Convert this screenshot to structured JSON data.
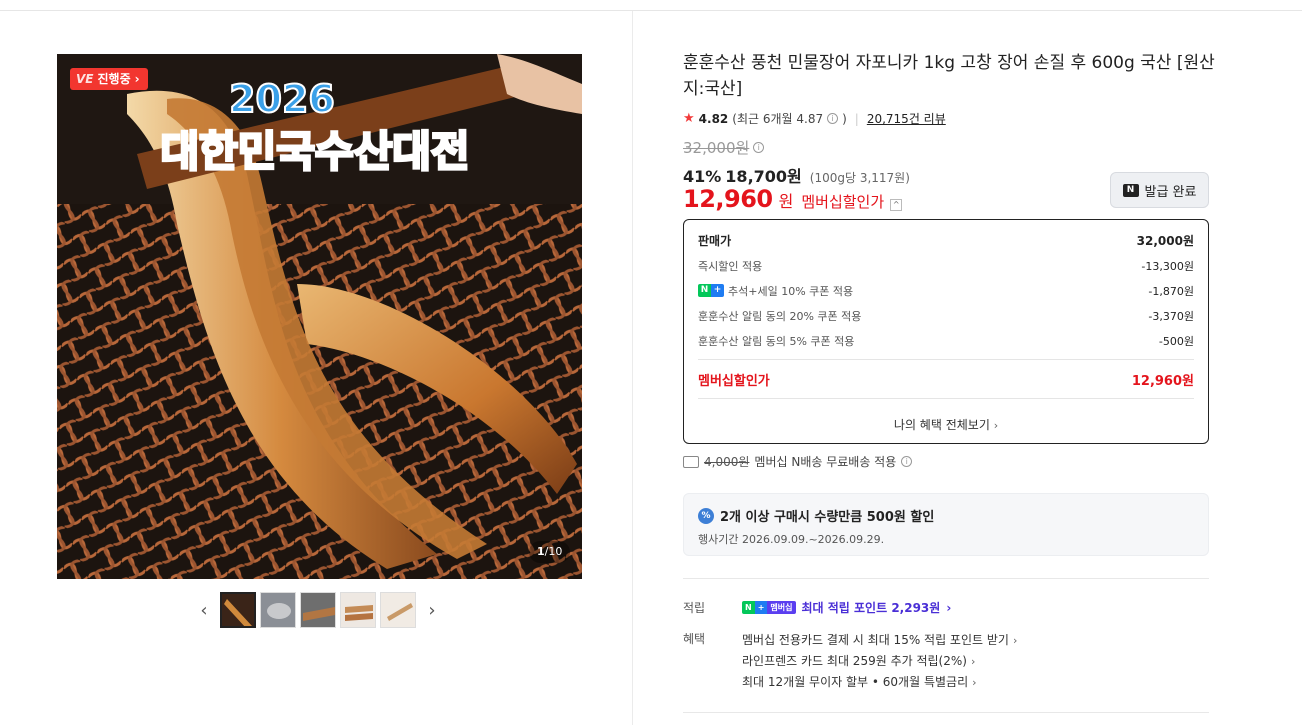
{
  "gallery": {
    "live_badge_prefix": "VE",
    "live_badge_label": "진행중",
    "banner_year": "2026",
    "banner_title": "대한민국수산대전",
    "counter_current": "1",
    "counter_total": "/10",
    "thumbnail_count": 5
  },
  "product": {
    "title": "훈훈수산 풍천 민물장어 자포니카 1kg 고창 장어 손질 후 600g 국산 [원산지:국산]",
    "rating": "4.82",
    "rating_recent": "(최근 6개월 4.87",
    "rating_recent_close": ")",
    "reviews": "20,715건 리뷰"
  },
  "price": {
    "original": "32,000원",
    "discount_pct": "41%",
    "sale_price": "18,700원",
    "unit_price": "(100g당 3,117원)",
    "member_price_num": "12,960",
    "member_price_won": "원",
    "member_price_label": "멤버십할인가",
    "issue_button": "발급 완료"
  },
  "breakdown": {
    "rows": [
      {
        "label": "판매가",
        "value": "32,000원"
      },
      {
        "label": "즉시할인 적용",
        "value": "-13,300원"
      },
      {
        "label": "추석+세일 10% 쿠폰 적용",
        "value": "-1,870원"
      },
      {
        "label": "훈훈수산 알림 동의 20% 쿠폰 적용",
        "value": "-3,370원"
      },
      {
        "label": "훈훈수산 알림 동의 5% 쿠폰 적용",
        "value": "-500원"
      }
    ],
    "total_label": "멤버십할인가",
    "total_value": "12,960원",
    "all_benefits": "나의 혜택 전체보기"
  },
  "shipping": {
    "fee": "4,000원",
    "text": "멤버십 N배송 무료배송 적용"
  },
  "promo": {
    "title": "2개 이상 구매시 수량만큼 500원 할인",
    "period": "행사기간 2026.09.09.~2026.09.29."
  },
  "earn": {
    "label": "적립",
    "badge_text": "멤버십",
    "text": "최대 적립 포인트 2,293원"
  },
  "benefits": {
    "label": "혜택",
    "items": [
      "멤버십 전용카드 결제 시 최대 15% 적립 포인트 받기",
      "라인프렌즈 카드 최대 259원 추가 적립(2%)",
      "최대 12개월 무이자 할부 • 60개월 특별금리"
    ]
  },
  "colors": {
    "accent_red": "#e4141c",
    "naver_green": "#03c75a",
    "plus_blue": "#1f7cf2",
    "membership_purple": "#4a2fd6"
  }
}
